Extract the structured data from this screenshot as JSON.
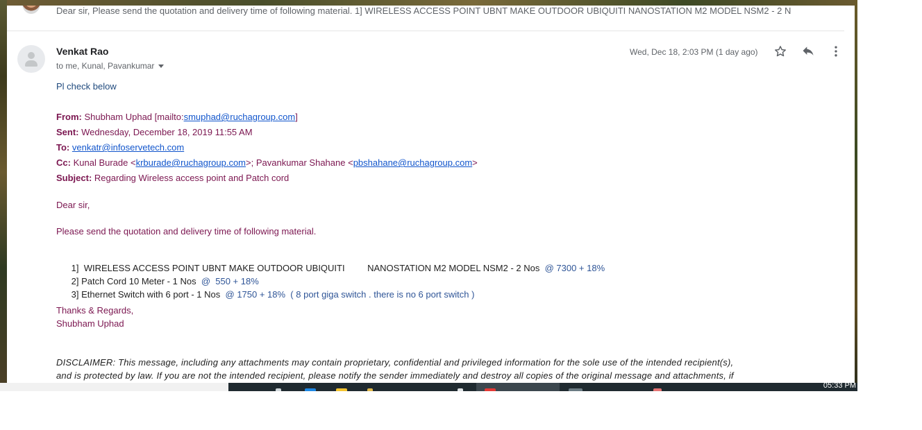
{
  "previous_message": {
    "snippet": "Dear sir, Please send the quotation and delivery time of following material. 1] WIRELESS ACCESS POINT UBNT MAKE OUTDOOR UBIQUITI NANOSTATION M2 MODEL NSM2 - 2 N"
  },
  "message": {
    "sender": "Venkat Rao",
    "recipients": "to me, Kunal, Pavankumar",
    "date": "Wed, Dec 18, 2:03 PM (1 day ago)",
    "intro": "Pl check below",
    "forwarded_header": {
      "from_label": "From:",
      "from_name": "Shubham Uphad [mailto:",
      "from_email": "smuphad@ruchagroup.com",
      "from_end": "]",
      "sent_label": "Sent:",
      "sent_value": "Wednesday, December 18, 2019 11:55 AM",
      "to_label": "To:",
      "to_email": "venkatr@infoservetech.com",
      "cc_label": "Cc:",
      "cc_name1": "Kunal Burade <",
      "cc_email1": "krburade@ruchagroup.com",
      "cc_mid": ">; Pavankumar Shahane <",
      "cc_email2": "pbshahane@ruchagroup.com",
      "cc_end": ">",
      "subject_label": "Subject:",
      "subject_value": "Regarding Wireless access point and Patch cord"
    },
    "greeting": "Dear sir,",
    "request": "Please send the quotation and delivery time of following material.",
    "items": [
      {
        "text": "1]  WIRELESS ACCESS POINT UBNT MAKE OUTDOOR UBIQUITI         NANOSTATION M2 MODEL NSM2 - 2 Nos",
        "note": "@ 7300 + 18%"
      },
      {
        "text": "2] Patch Cord 10 Meter - 1 Nos",
        "note": "@  550 + 18%"
      },
      {
        "text": "3] Ethernet Switch with 6 port - 1 Nos",
        "note": "@ 1750 + 18%  ( 8 port giga switch . there is no 6 port switch )"
      }
    ],
    "closing": "Thanks & Regards,",
    "signature": "Shubham Uphad",
    "disclaimer_line1": "DISCLAIMER: This message, including any attachments may contain proprietary, confidential and privileged information for the sole use of the intended recipient(s),",
    "disclaimer_line2": "and is protected by law. If you are not the intended recipient, please notify the sender immediately and destroy all copies of the original message and attachments, if"
  },
  "actions": {
    "star_icon": "star-outline-icon",
    "reply_icon": "reply-icon",
    "more_icon": "more-vertical-icon"
  },
  "taskbar": {
    "clock": "05:33 PM"
  },
  "colors": {
    "blue_text": "#1f497d",
    "purple_text": "#7b1650",
    "link": "#1155cc"
  }
}
